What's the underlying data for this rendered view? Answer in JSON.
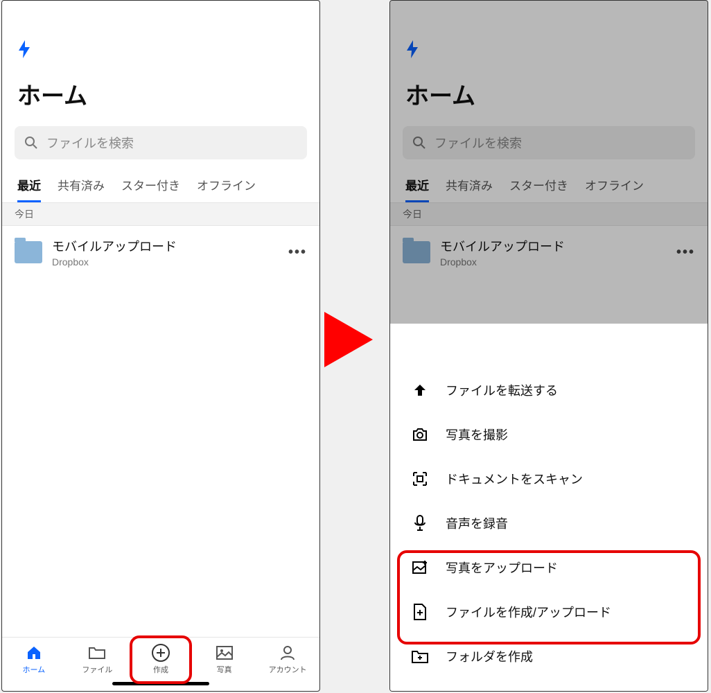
{
  "left": {
    "title": "ホーム",
    "search_placeholder": "ファイルを検索",
    "tabs": [
      "最近",
      "共有済み",
      "スター付き",
      "オフライン"
    ],
    "section": "今日",
    "item": {
      "name": "モバイルアップロード",
      "sub": "Dropbox"
    },
    "nav": {
      "home": "ホーム",
      "files": "ファイル",
      "create": "作成",
      "photos": "写真",
      "account": "アカウント"
    }
  },
  "right": {
    "title": "ホーム",
    "search_placeholder": "ファイルを検索",
    "tabs": [
      "最近",
      "共有済み",
      "スター付き",
      "オフライン"
    ],
    "section": "今日",
    "item": {
      "name": "モバイルアップロード",
      "sub": "Dropbox"
    },
    "sheet": {
      "transfer": "ファイルを転送する",
      "photo": "写真を撮影",
      "scan": "ドキュメントをスキャン",
      "audio": "音声を録音",
      "upload_photo": "写真をアップロード",
      "upload_file": "ファイルを作成/アップロード",
      "folder": "フォルダを作成"
    }
  }
}
